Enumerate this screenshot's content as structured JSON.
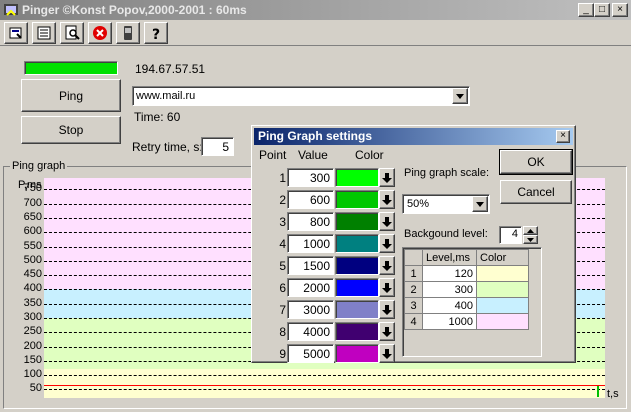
{
  "window": {
    "title": "Pinger ©Konst Popov,2000-2001 : 60ms",
    "minimize": "_",
    "maximize": "□",
    "close": "×"
  },
  "toolbar": {
    "buttons": [
      "settings-icon",
      "list-icon",
      "find-icon",
      "stop-icon",
      "device-icon",
      "help-icon"
    ]
  },
  "main": {
    "status_color": "#00e000",
    "ip": "194.67.57.51",
    "ping_label": "Ping",
    "stop_label": "Stop",
    "host_value": "www.mail.ru",
    "time_text": "Time: 60",
    "retry_label": "Retry time, s:",
    "retry_value": "5"
  },
  "graph": {
    "legend": "Ping graph",
    "y_axis_label": "P,ms",
    "x_axis_label": "t,s",
    "ticks": [
      "750",
      "700",
      "650",
      "600",
      "550",
      "500",
      "450",
      "400",
      "350",
      "300",
      "250",
      "200",
      "150",
      "100",
      "50"
    ],
    "bands": [
      {
        "color": "#ffe0ff",
        "from": 400,
        "to": 790
      },
      {
        "color": "#c8f0ff",
        "from": 300,
        "to": 400
      },
      {
        "color": "#e0ffc0",
        "from": 120,
        "to": 300
      },
      {
        "color": "#ffffd0",
        "from": 0,
        "to": 120
      }
    ]
  },
  "dialog": {
    "title": "Ping Graph settings",
    "close": "×",
    "col_point": "Point",
    "col_value": "Value",
    "col_color": "Color",
    "points": [
      {
        "n": "1",
        "value": "300",
        "color": "#00ff00"
      },
      {
        "n": "2",
        "value": "600",
        "color": "#00c800"
      },
      {
        "n": "3",
        "value": "800",
        "color": "#008000"
      },
      {
        "n": "4",
        "value": "1000",
        "color": "#008080"
      },
      {
        "n": "5",
        "value": "1500",
        "color": "#000080"
      },
      {
        "n": "6",
        "value": "2000",
        "color": "#0000ff"
      },
      {
        "n": "7",
        "value": "3000",
        "color": "#8080c8"
      },
      {
        "n": "8",
        "value": "4000",
        "color": "#400070"
      },
      {
        "n": "9",
        "value": "5000",
        "color": "#c000c0"
      }
    ],
    "ok_label": "OK",
    "cancel_label": "Cancel",
    "scale_label": "Ping graph scale:",
    "scale_value": "50%",
    "background_label": "Backgound level:",
    "background_value": "4",
    "levels_header": {
      "level": "Level,ms",
      "color": "Color"
    },
    "levels": [
      {
        "n": "1",
        "value": "120",
        "color": "#ffffd0"
      },
      {
        "n": "2",
        "value": "300",
        "color": "#e0ffc0"
      },
      {
        "n": "3",
        "value": "400",
        "color": "#c8f0ff"
      },
      {
        "n": "4",
        "value": "1000",
        "color": "#ffe0ff"
      }
    ]
  }
}
